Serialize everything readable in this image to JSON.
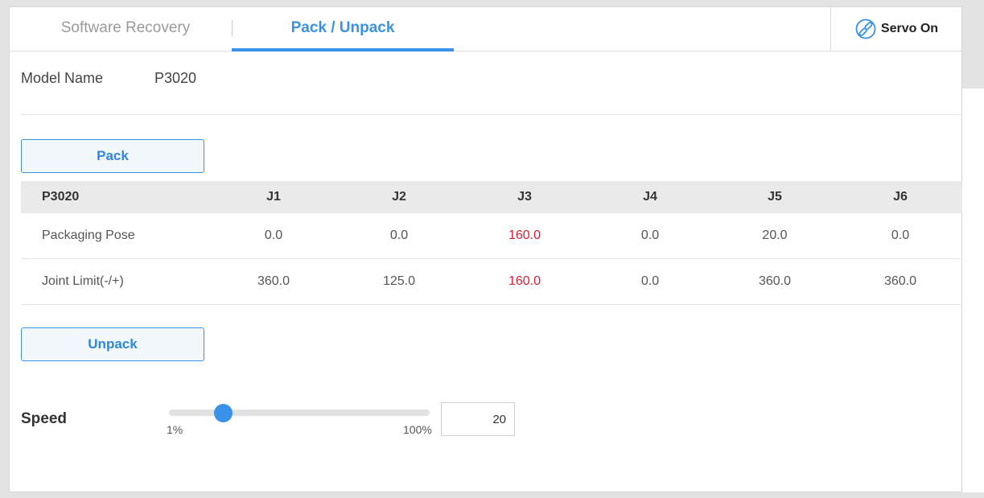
{
  "tabs": [
    {
      "label": "Software Recovery",
      "active": false
    },
    {
      "label": "Pack / Unpack",
      "active": true
    }
  ],
  "servo": {
    "label": "Servo On",
    "icon": "servo-link-icon"
  },
  "model": {
    "label": "Model Name",
    "value": "P3020"
  },
  "buttons": {
    "pack": "Pack",
    "unpack": "Unpack"
  },
  "table": {
    "headers": [
      "P3020",
      "J1",
      "J2",
      "J3",
      "J4",
      "J5",
      "J6"
    ],
    "rows": [
      {
        "label": "Packaging Pose",
        "values": [
          "0.0",
          "0.0",
          "160.0",
          "0.0",
          "20.0",
          "0.0"
        ]
      },
      {
        "label": "Joint Limit(-/+)",
        "values": [
          "360.0",
          "125.0",
          "160.0",
          "0.0",
          "360.0",
          "360.0"
        ]
      }
    ]
  },
  "speed": {
    "label": "Speed",
    "min_label": "1%",
    "max_label": "100%",
    "value": "20",
    "min": 1,
    "max": 100
  },
  "colors": {
    "accent": "#3a91e8",
    "warning": "#d81e35",
    "header_bg": "#eaeaea"
  }
}
